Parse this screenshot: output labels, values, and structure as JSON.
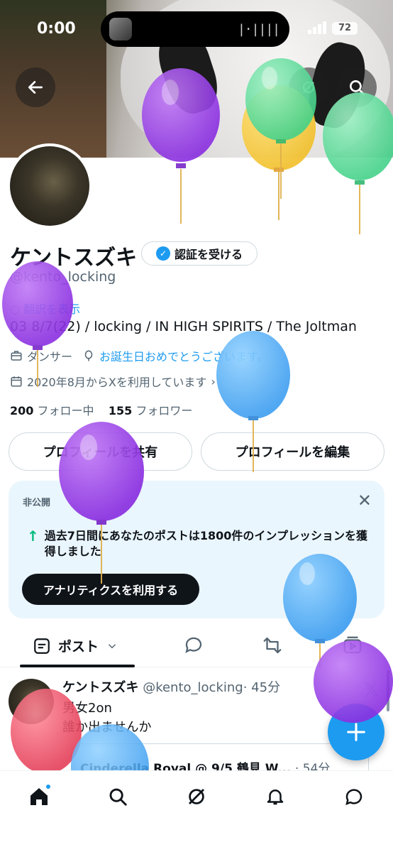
{
  "status_bar": {
    "time": "0:00",
    "battery": "72"
  },
  "profile": {
    "name": "ケントスズキ",
    "verify_label": "認証を受ける",
    "handle": "@kento_locking",
    "translate_label": "翻訳を表示",
    "bio": "03 8/7(22) / locking / IN HIGH SPIRITS / The Joltman",
    "category": "ダンサー",
    "birthday_text": "お誕生日おめでとうございます。",
    "joined": "2020年8月からXを利用しています",
    "following_count": "200",
    "following_label": "フォロー中",
    "followers_count": "155",
    "followers_label": "フォロワー"
  },
  "buttons": {
    "share_profile": "プロフィールを共有",
    "edit_profile": "プロフィールを編集"
  },
  "private_card": {
    "label": "非公開",
    "impression_text": "過去7日間にあなたのポストは1800件のインプレッションを獲得しました",
    "analytics_button": "アナリティクスを利用する"
  },
  "tabs": {
    "posts_label": "ポスト"
  },
  "post": {
    "author": "ケントスズキ",
    "handle": "@kento_locking",
    "time": "· 45分",
    "text_line1": "男女2on",
    "text_line2": "誰か出ませんか",
    "quote_text": "Cinderella Royal @ 9/5 鶴見 W...",
    "quote_time": "· 54分"
  },
  "colors": {
    "accent": "#1d9bf0",
    "text": "#0f1419",
    "secondary": "#536471",
    "card_bg": "#eaf6fd"
  }
}
